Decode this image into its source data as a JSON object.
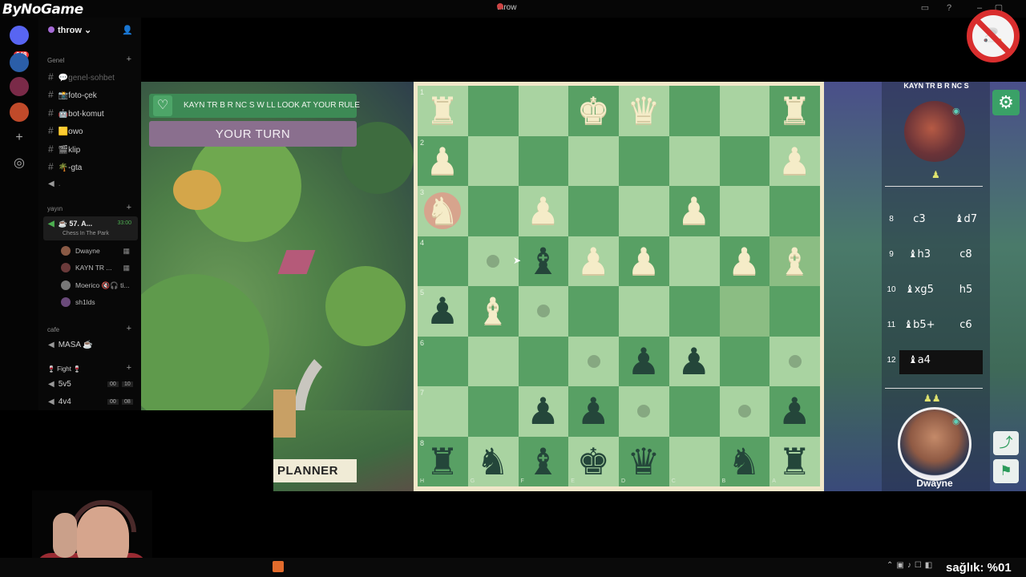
{
  "window": {
    "brand": "ByNoGame",
    "title": "throw"
  },
  "discord": {
    "server_badge": "248",
    "guild_name": "throw",
    "categories": {
      "genel": "Genel",
      "yayin": "yayın",
      "cafe": "cafe",
      "fight": "🍷 Fight 🍷"
    },
    "text_channels": [
      {
        "label": "💬genel-sohbet",
        "dim": true
      },
      {
        "label": "📸foto-çek",
        "dim": false
      },
      {
        "label": "🤖bot-komut",
        "dim": false
      },
      {
        "label": "🟨owo",
        "dim": false
      },
      {
        "label": "🎬klip",
        "dim": false
      },
      {
        "label": "🌴-gta",
        "dim": false
      },
      {
        "label": ".",
        "dim": false
      }
    ],
    "voice_active": {
      "title": "☕ 57. A...",
      "time": "33:00",
      "subtitle": "Chess In The Park"
    },
    "members": [
      "Dwayne",
      "KAYN TR ...",
      "Moerico 🔇🎧 ti...",
      "sh1lds"
    ],
    "cafe_channel": "MASA ☕",
    "fight_channels": [
      {
        "label": "5v5",
        "count_a": "00",
        "count_b": "10"
      },
      {
        "label": "4v4",
        "count_a": "00",
        "count_b": "08"
      }
    ]
  },
  "game": {
    "message": "KAYN TR B R NC S  W LL LOOK AT YOUR RULE",
    "turn_text": "YOUR TURN",
    "planner_label": "PLANNER",
    "opponent_name": "KAYN TR B R NC S",
    "player_name": "Dwayne",
    "rank_labels": [
      "1",
      "2",
      "3",
      "4",
      "5",
      "6",
      "7",
      "8"
    ],
    "file_labels": [
      "H",
      "G",
      "F",
      "E",
      "D",
      "C",
      "B",
      "A"
    ],
    "moves": [
      {
        "num": "8",
        "white": "c3",
        "black": "♝d7"
      },
      {
        "num": "9",
        "white": "♝h3",
        "black": "c8"
      },
      {
        "num": "10",
        "white": "♝xg5",
        "black": "h5"
      },
      {
        "num": "11",
        "white": "♝b5+",
        "black": "c6"
      },
      {
        "num": "12",
        "white": "♝a4",
        "black": ""
      }
    ],
    "pieces": [
      {
        "glyph": "♜",
        "color": "w",
        "col": 0,
        "row": 0
      },
      {
        "glyph": "♚",
        "color": "w",
        "col": 3,
        "row": 0
      },
      {
        "glyph": "♛",
        "color": "w",
        "col": 4,
        "row": 0
      },
      {
        "glyph": "♜",
        "color": "w",
        "col": 7,
        "row": 0
      },
      {
        "glyph": "♟",
        "color": "w",
        "col": 0,
        "row": 1
      },
      {
        "glyph": "♟",
        "color": "w",
        "col": 7,
        "row": 1
      },
      {
        "glyph": "♞",
        "color": "w",
        "col": 0,
        "row": 2
      },
      {
        "glyph": "♟",
        "color": "w",
        "col": 2,
        "row": 2
      },
      {
        "glyph": "♟",
        "color": "w",
        "col": 5,
        "row": 2
      },
      {
        "glyph": "♝",
        "color": "b",
        "col": 2,
        "row": 3
      },
      {
        "glyph": "♟",
        "color": "w",
        "col": 3,
        "row": 3
      },
      {
        "glyph": "♟",
        "color": "w",
        "col": 4,
        "row": 3
      },
      {
        "glyph": "♟",
        "color": "w",
        "col": 6,
        "row": 3
      },
      {
        "glyph": "♝",
        "color": "w",
        "col": 7,
        "row": 3
      },
      {
        "glyph": "♟",
        "color": "b",
        "col": 0,
        "row": 4
      },
      {
        "glyph": "♝",
        "color": "w",
        "col": 1,
        "row": 4
      },
      {
        "glyph": "♟",
        "color": "b",
        "col": 4,
        "row": 5
      },
      {
        "glyph": "♟",
        "color": "b",
        "col": 5,
        "row": 5
      },
      {
        "glyph": "♟",
        "color": "b",
        "col": 2,
        "row": 6
      },
      {
        "glyph": "♟",
        "color": "b",
        "col": 3,
        "row": 6
      },
      {
        "glyph": "♟",
        "color": "b",
        "col": 7,
        "row": 6
      },
      {
        "glyph": "♜",
        "color": "b",
        "col": 0,
        "row": 7
      },
      {
        "glyph": "♞",
        "color": "b",
        "col": 1,
        "row": 7
      },
      {
        "glyph": "♝",
        "color": "b",
        "col": 2,
        "row": 7
      },
      {
        "glyph": "♚",
        "color": "b",
        "col": 3,
        "row": 7
      },
      {
        "glyph": "♛",
        "color": "b",
        "col": 4,
        "row": 7
      },
      {
        "glyph": "♞",
        "color": "b",
        "col": 6,
        "row": 7
      },
      {
        "glyph": "♜",
        "color": "b",
        "col": 7,
        "row": 7
      }
    ],
    "move_dots": [
      {
        "col": 1,
        "row": 3
      },
      {
        "col": 2,
        "row": 4
      },
      {
        "col": 3,
        "row": 5
      },
      {
        "col": 7,
        "row": 5
      },
      {
        "col": 4,
        "row": 6
      },
      {
        "col": 6,
        "row": 6
      }
    ],
    "highlight_squares": [
      {
        "col": 6,
        "row": 4
      },
      {
        "col": 7,
        "row": 3
      }
    ]
  },
  "overlay": {
    "health_text": "sağlık: %01"
  },
  "colors": {
    "board_light": "#a9d3a1",
    "board_dark": "#58a064",
    "accent_green": "#3aa167"
  },
  "icons": [
    "heart-icon",
    "gear-icon",
    "share-icon",
    "flag-icon",
    "eye-icon",
    "no-smoking-icon",
    "speaker-icon",
    "hash-icon",
    "plus-icon"
  ]
}
